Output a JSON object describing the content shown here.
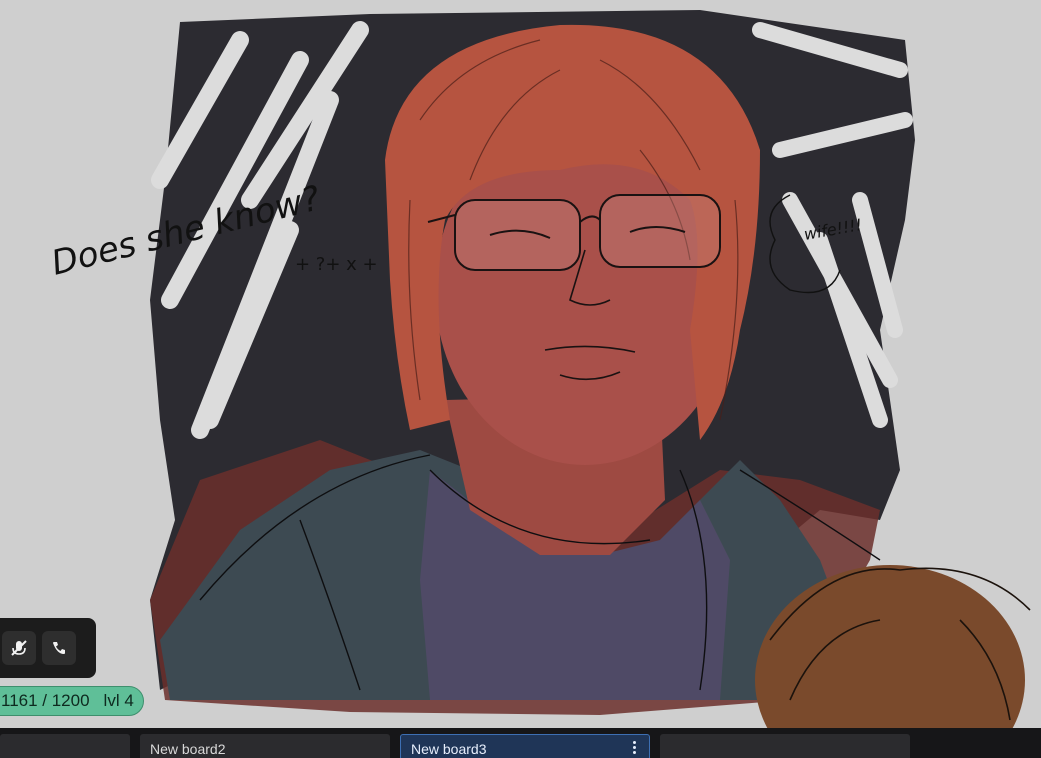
{
  "canvas": {
    "annotation_main": "Does she know?",
    "annotation_side": "wife!!!!",
    "annotation_marks": "+ ?+ x +",
    "colors": {
      "background": "#cfcfcf",
      "shadow": "#2c2b31",
      "skin": "#a9504a",
      "hair": "#b65440",
      "hoodie": "#3d4a52",
      "shirt": "#4f4a66",
      "second_hair": "#7a4a2c"
    }
  },
  "call_controls": {
    "buttons": [
      {
        "icon": "microphone-muted-icon"
      },
      {
        "icon": "phone-icon"
      }
    ]
  },
  "xp": {
    "progress": "1161 / 1200",
    "level": "lvl 4",
    "fill_fraction": 0.9675
  },
  "tabs": [
    {
      "label": ""
    },
    {
      "label": "New board2"
    },
    {
      "label": "New board3",
      "active": true
    },
    {
      "label": ""
    }
  ]
}
